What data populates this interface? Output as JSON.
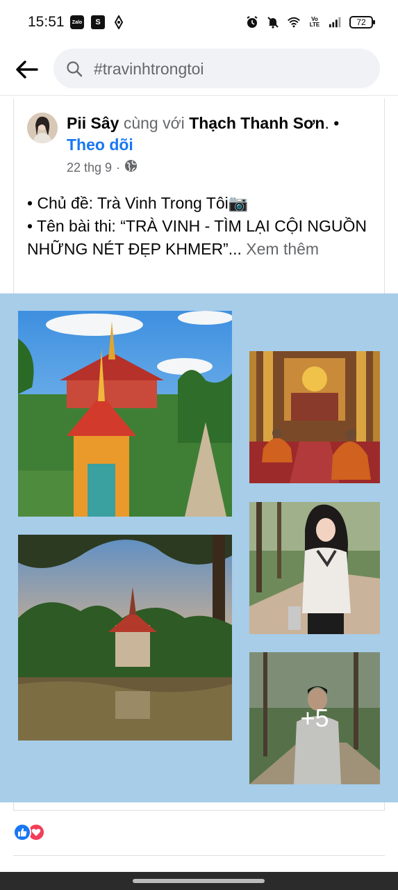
{
  "status_bar": {
    "time": "15:51",
    "zalo_label": "Zalo",
    "battery": "72",
    "volte": "Vo\nLTE",
    "left_icons": [
      "zalo-icon",
      "shop-icon",
      "ring-icon"
    ],
    "right_icons": [
      "alarm-icon",
      "mute-icon",
      "wifi-icon",
      "volte-icon",
      "signal-icon",
      "battery-icon"
    ]
  },
  "search": {
    "query": "#travinhtrongtoi"
  },
  "post": {
    "author": "Pii Sây",
    "with_text": " cùng với ",
    "tagged": "Thạch Thanh Sơn",
    "dot": ". •",
    "follow": "Theo dõi",
    "date": "22 thg 9",
    "meta_sep": "·",
    "line1": "• Chủ đề: Trà Vinh Trong Tôi📷",
    "line2": "• Tên bài thi: “TRÀ VINH - TÌM LẠI CỘI NGUỒN NHỮNG NÉT ĐẸP KHMER”...",
    "see_more": " Xem thêm",
    "more_photos": "+5"
  },
  "colors": {
    "accent": "#1877f2",
    "collage_bg": "#a7cde9",
    "like": "#1877f2",
    "love": "#f33e58"
  }
}
